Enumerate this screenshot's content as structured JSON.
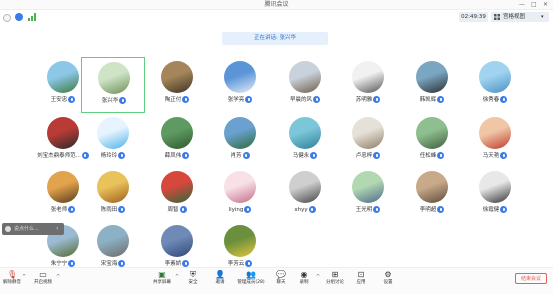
{
  "window": {
    "title": "腾讯会议",
    "min_glyph": "—",
    "max_glyph": "□",
    "close_glyph": "✕"
  },
  "infobar": {
    "time": "02:49:39",
    "view_label": "宫格视图"
  },
  "speaking": "正在讲话: 张兴华",
  "participants": [
    {
      "name": "王安忠"
    },
    {
      "name": "张兴华"
    },
    {
      "name": "陶正付"
    },
    {
      "name": "张学亮"
    },
    {
      "name": "早晨的风"
    },
    {
      "name": "苏明雅"
    },
    {
      "name": "韩凯辉"
    },
    {
      "name": "徐秀春"
    },
    {
      "name": "刘宝杰鼎泰师范..."
    },
    {
      "name": "杨玲玲"
    },
    {
      "name": "薛凤伟"
    },
    {
      "name": "肖芳"
    },
    {
      "name": "马健永"
    },
    {
      "name": "卢忠梓"
    },
    {
      "name": "任松峰"
    },
    {
      "name": "马天艳"
    },
    {
      "name": "张老师"
    },
    {
      "name": "陈雨田"
    },
    {
      "name": "周智"
    },
    {
      "name": "liying"
    },
    {
      "name": "xhyy"
    },
    {
      "name": "王光明"
    },
    {
      "name": "李明超"
    },
    {
      "name": "徐霞健"
    },
    {
      "name": "朱宁宁"
    },
    {
      "name": "宋宝海"
    },
    {
      "name": "李素娇"
    },
    {
      "name": "李芳云"
    }
  ],
  "chat_placeholder": "说点什么...",
  "toolbar": {
    "mute": "解除静音",
    "video": "开启视频",
    "share": "共享屏幕",
    "security": "安全",
    "invite": "邀请",
    "members": "管理成员(28)",
    "chat": "聊天",
    "record": "录制",
    "breakout": "分组讨论",
    "apps": "应用",
    "settings": "设置",
    "end": "结束会议"
  },
  "colors": {
    "accent": "#3a7bea",
    "selected_border": "#5fcf7e",
    "end": "#e0605a"
  }
}
